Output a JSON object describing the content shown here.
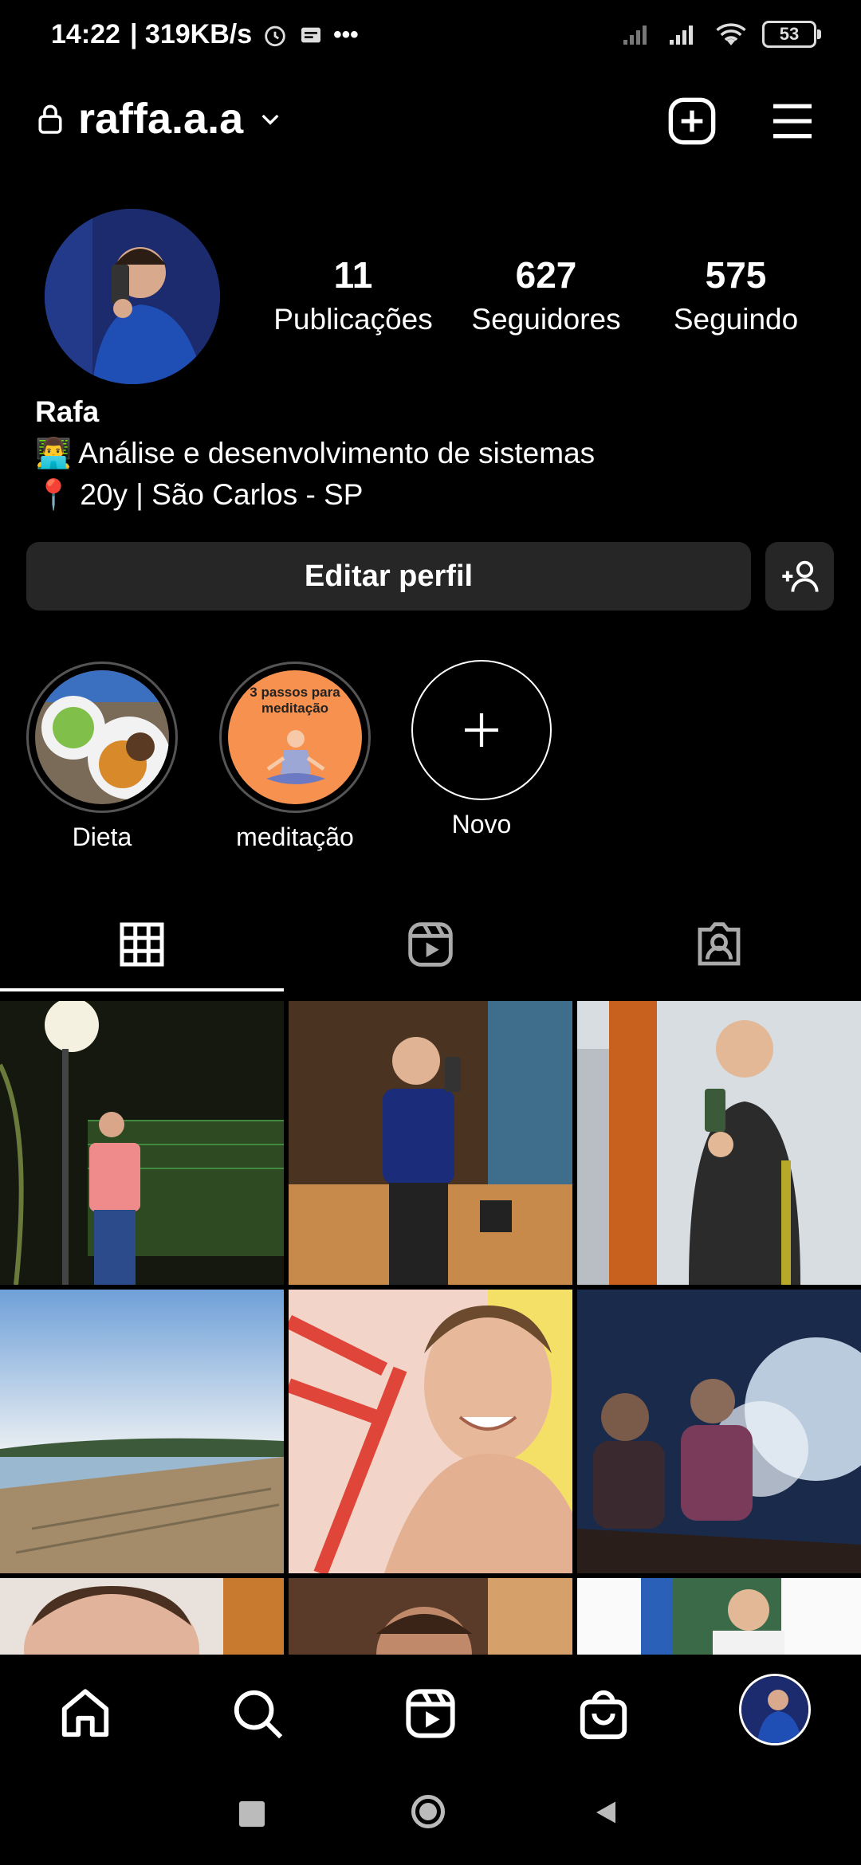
{
  "status_bar": {
    "time": "14:22",
    "network_speed": "| 319KB/s",
    "battery": "53"
  },
  "header": {
    "username": "raffa.a.a"
  },
  "profile": {
    "posts_count": "11",
    "posts_label": "Publicações",
    "followers_count": "627",
    "followers_label": "Seguidores",
    "following_count": "575",
    "following_label": "Seguindo",
    "name": "Rafa",
    "bio_line1": "👨‍💻 Análise e desenvolvimento de sistemas",
    "bio_line2": "📍 20y | São Carlos - SP"
  },
  "buttons": {
    "edit_profile": "Editar perfil"
  },
  "highlights": [
    {
      "label": "Dieta"
    },
    {
      "label": "meditação",
      "cover_text": "3 passos para meditação"
    },
    {
      "label": "Novo"
    }
  ],
  "colors": {
    "background": "#000000",
    "button_bg": "#262626",
    "meditation_orange": "#f7914f"
  }
}
